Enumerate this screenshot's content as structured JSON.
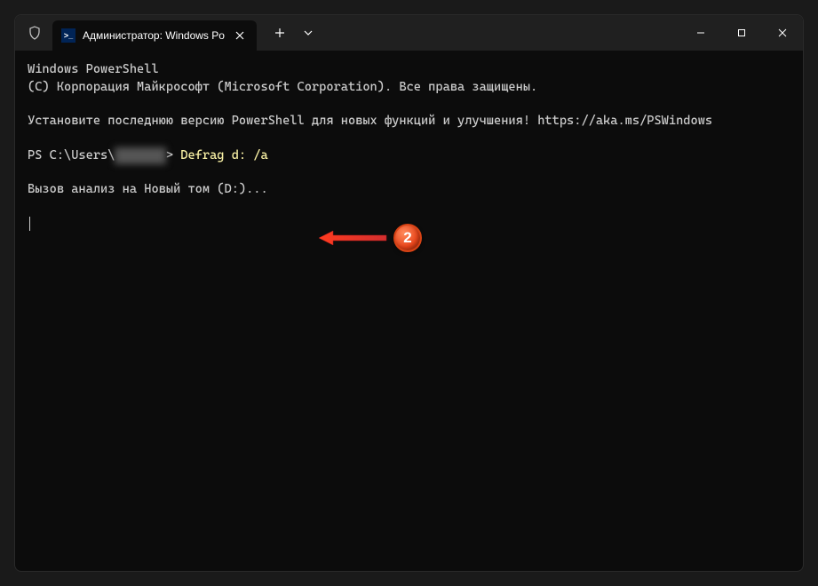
{
  "tab": {
    "title": "Администратор: Windows Po",
    "icon_label": ">_"
  },
  "terminal": {
    "line1": "Windows PowerShell",
    "line2": "(C) Корпорация Майкрософт (Microsoft Corporation). Все права защищены.",
    "line3": "Установите последнюю версию PowerShell для новых функций и улучшения! https://aka.ms/PSWindows",
    "prompt_prefix": "PS C:\\Users\\",
    "prompt_user_blurred": "XXXXXXX",
    "prompt_suffix": "> ",
    "command": "Defrag d: /a",
    "line5": "Вызов анализ на Новый том (D:)..."
  },
  "annotation": {
    "badge_number": "2"
  }
}
